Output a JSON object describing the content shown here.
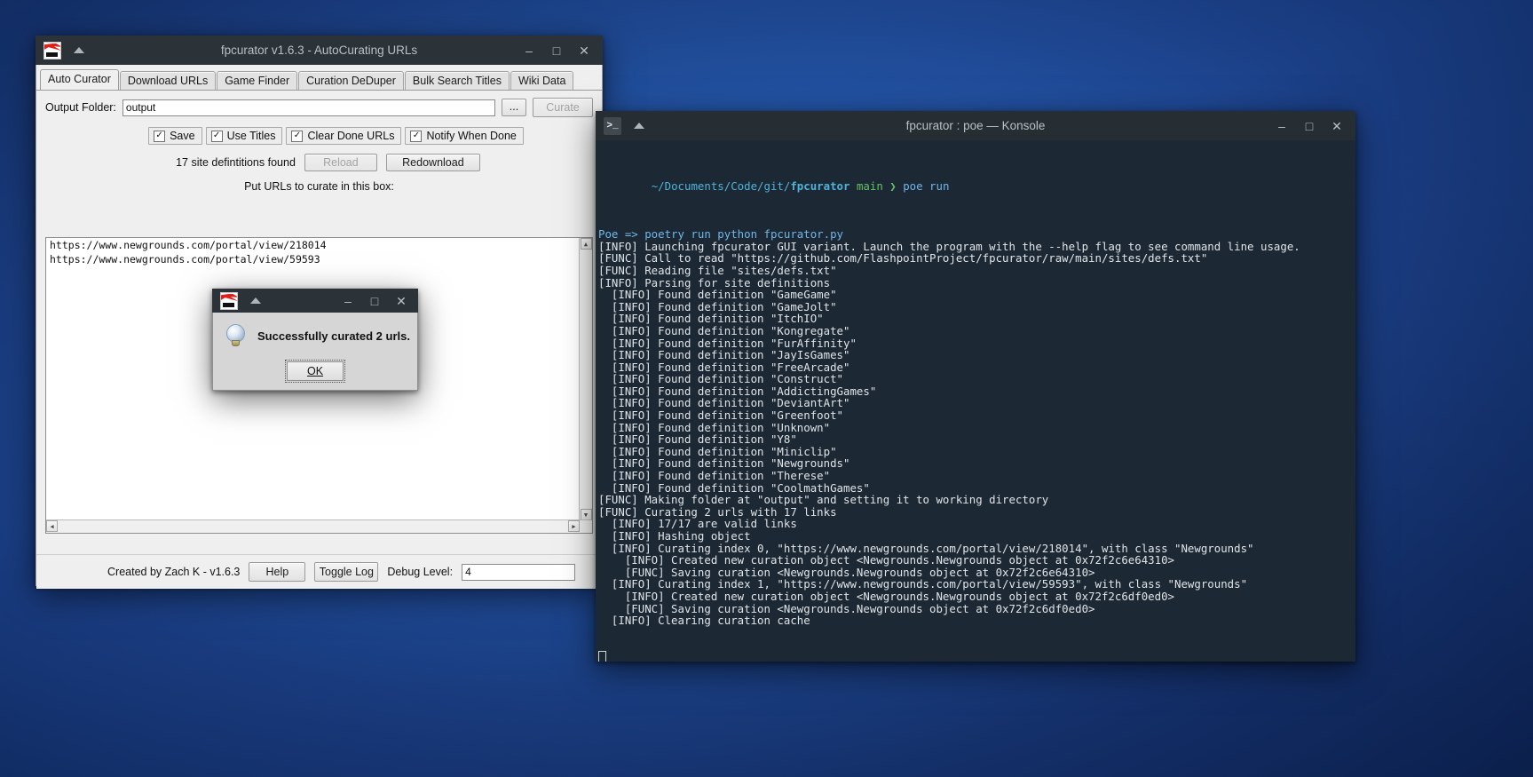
{
  "desktop": {
    "background": "#2558ad"
  },
  "fpcurator": {
    "title": "fpcurator v1.6.3 - AutoCurating URLs",
    "icon": "fpcurator-icon",
    "titlebar_buttons": {
      "minimize": "–",
      "maximize": "□",
      "close": "✕"
    },
    "tabs": [
      {
        "label": "Auto Curator",
        "active": true
      },
      {
        "label": "Download URLs",
        "active": false
      },
      {
        "label": "Game Finder",
        "active": false
      },
      {
        "label": "Curation DeDuper",
        "active": false
      },
      {
        "label": "Bulk Search Titles",
        "active": false
      },
      {
        "label": "Wiki Data",
        "active": false
      }
    ],
    "output_folder": {
      "label": "Output Folder:",
      "value": "output",
      "placeholder": "",
      "browse_label": "...",
      "curate_label": "Curate",
      "curate_disabled": true
    },
    "checkboxes": [
      {
        "label": "Save",
        "checked": true
      },
      {
        "label": "Use Titles",
        "checked": true
      },
      {
        "label": "Clear Done URLs",
        "checked": true
      },
      {
        "label": "Notify When Done",
        "checked": true
      }
    ],
    "defs_status": "17 site defintitions found",
    "reload_label": "Reload",
    "reload_disabled": true,
    "redownload_label": "Redownload",
    "urls_prompt": "Put URLs to curate in this box:",
    "urls": [
      "https://www.newgrounds.com/portal/view/218014",
      "https://www.newgrounds.com/portal/view/59593"
    ],
    "statusbar": {
      "credit": "Created by Zach K - v1.6.3",
      "help_label": "Help",
      "toggle_log_label": "Toggle Log",
      "debug_label": "Debug Level:",
      "debug_value": "4"
    }
  },
  "dialog": {
    "icon": "lightbulb-icon",
    "titlebar_buttons": {
      "minimize": "–",
      "maximize": "□",
      "close": "✕"
    },
    "message": "Successfully curated 2 urls.",
    "ok_label": "OK",
    "ok_accelerator": "O"
  },
  "konsole": {
    "title": "fpcurator : poe — Konsole",
    "icon": "konsole-icon",
    "titlebar_buttons": {
      "minimize": "–",
      "maximize": "□",
      "close": "✕"
    },
    "prompt": {
      "path": "~/Documents/Code/git/",
      "path_bold": "fpcurator",
      "branch": "main",
      "symbol": "❯",
      "command": "poe run"
    },
    "lines": [
      "Poe => poetry run python fpcurator.py",
      "[INFO] Launching fpcurator GUI variant. Launch the program with the --help flag to see command line usage.",
      "[FUNC] Call to read \"https://github.com/FlashpointProject/fpcurator/raw/main/sites/defs.txt\"",
      "[FUNC] Reading file \"sites/defs.txt\"",
      "[INFO] Parsing for site definitions",
      "  [INFO] Found definition \"GameGame\"",
      "  [INFO] Found definition \"GameJolt\"",
      "  [INFO] Found definition \"ItchIO\"",
      "  [INFO] Found definition \"Kongregate\"",
      "  [INFO] Found definition \"FurAffinity\"",
      "  [INFO] Found definition \"JayIsGames\"",
      "  [INFO] Found definition \"FreeArcade\"",
      "  [INFO] Found definition \"Construct\"",
      "  [INFO] Found definition \"AddictingGames\"",
      "  [INFO] Found definition \"DeviantArt\"",
      "  [INFO] Found definition \"Greenfoot\"",
      "  [INFO] Found definition \"Unknown\"",
      "  [INFO] Found definition \"Y8\"",
      "  [INFO] Found definition \"Miniclip\"",
      "  [INFO] Found definition \"Newgrounds\"",
      "  [INFO] Found definition \"Therese\"",
      "  [INFO] Found definition \"CoolmathGames\"",
      "[FUNC] Making folder at \"output\" and setting it to working directory",
      "[FUNC] Curating 2 urls with 17 links",
      "  [INFO] 17/17 are valid links",
      "  [INFO] Hashing object",
      "  [INFO] Curating index 0, \"https://www.newgrounds.com/portal/view/218014\", with class \"Newgrounds\"",
      "    [INFO] Created new curation object <Newgrounds.Newgrounds object at 0x72f2c6e64310>",
      "    [FUNC] Saving curation <Newgrounds.Newgrounds object at 0x72f2c6e64310>",
      "  [INFO] Curating index 1, \"https://www.newgrounds.com/portal/view/59593\", with class \"Newgrounds\"",
      "    [INFO] Created new curation object <Newgrounds.Newgrounds object at 0x72f2c6df0ed0>",
      "    [FUNC] Saving curation <Newgrounds.Newgrounds object at 0x72f2c6df0ed0>",
      "  [INFO] Clearing curation cache"
    ]
  }
}
